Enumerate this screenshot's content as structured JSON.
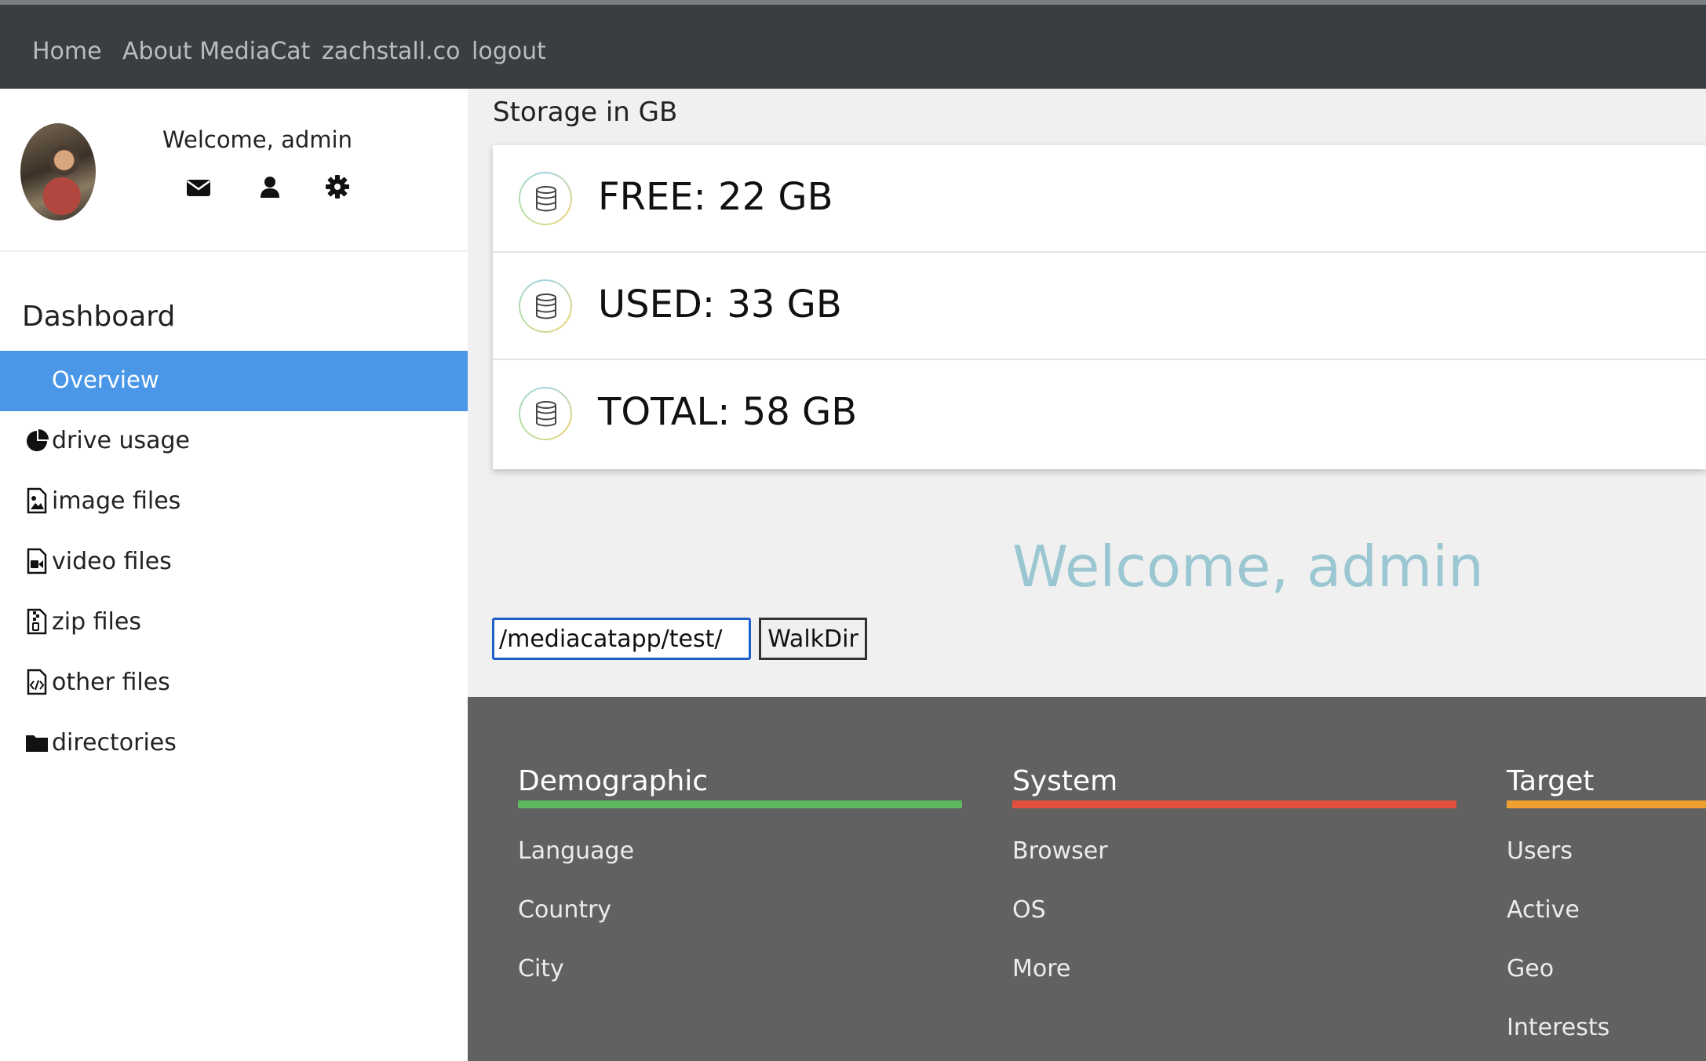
{
  "topnav": {
    "home": "Home",
    "about": "About MediaCat",
    "site": "zachstall.co",
    "logout": "logout"
  },
  "profile": {
    "welcome": "Welcome, admin"
  },
  "sidebar": {
    "title": "Dashboard",
    "active": "Overview",
    "items": [
      {
        "label": "drive usage",
        "icon": "pie-chart-icon"
      },
      {
        "label": "image files",
        "icon": "image-file-icon"
      },
      {
        "label": "video files",
        "icon": "video-file-icon"
      },
      {
        "label": "zip files",
        "icon": "zip-file-icon"
      },
      {
        "label": "other files",
        "icon": "code-file-icon"
      },
      {
        "label": "directories",
        "icon": "folder-icon"
      }
    ]
  },
  "storage": {
    "title": "Storage in GB",
    "rows": [
      {
        "label": "FREE: 22 GB",
        "icon": "database-icon"
      },
      {
        "label": "USED: 33 GB",
        "icon": "database-icon"
      },
      {
        "label": "TOTAL: 58 GB",
        "icon": "database-icon"
      }
    ]
  },
  "main": {
    "welcome": "Welcome, admin",
    "path_value": "/mediacatapp/test/",
    "walk_button": "WalkDir"
  },
  "footer": {
    "columns": [
      {
        "title": "Demographic",
        "color": "#5cb85c",
        "links": [
          "Language",
          "Country",
          "City"
        ]
      },
      {
        "title": "System",
        "color": "#e0503c",
        "links": [
          "Browser",
          "OS",
          "More"
        ]
      },
      {
        "title": "Target",
        "color": "#f0a030",
        "links": [
          "Users",
          "Active",
          "Geo",
          "Interests"
        ]
      }
    ]
  },
  "colors": {
    "nav_bg": "#3a3e42",
    "active": "#4a97e8",
    "welcome": "#9bc7d2",
    "footer_bg": "#616161"
  }
}
